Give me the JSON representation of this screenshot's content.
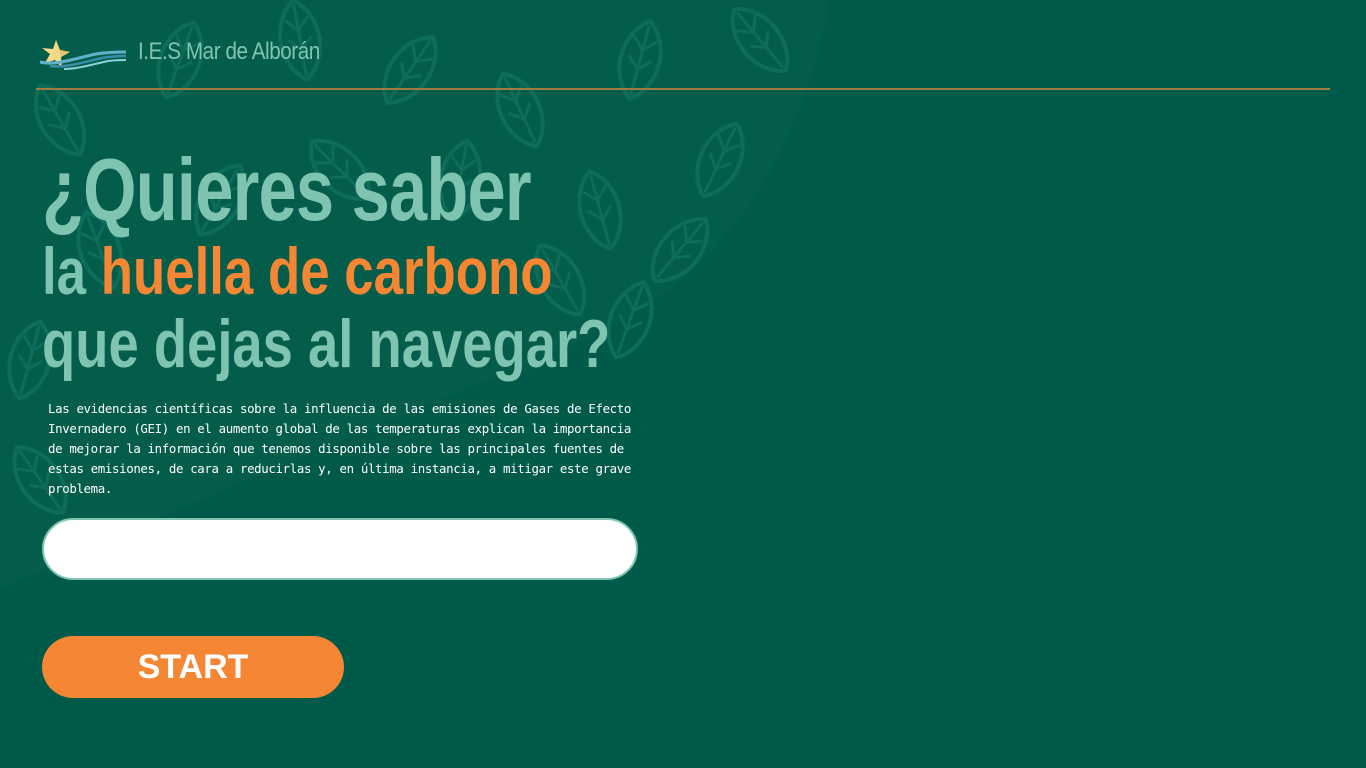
{
  "header": {
    "school_name": "I.E.S Mar de Alborán",
    "logo_icon": "star-wave-logo-icon"
  },
  "hero": {
    "line1": "¿Quieres saber",
    "line2_prefix": "la ",
    "line2_accent": "huella de carbono",
    "line3": "que dejas al navegar?"
  },
  "description": "Las evidencias científicas sobre la influencia de las emisiones de Gases de Efecto Invernadero (GEI) en el aumento global de las temperaturas explican la importancia de mejorar la información que tenemos disponible sobre las principales fuentes de estas emisiones, de cara a reducirlas y, en última instancia, a mitigar este grave problema.",
  "url_input": {
    "value": "",
    "placeholder": ""
  },
  "start_button": {
    "label": "START"
  },
  "colors": {
    "background": "#005a49",
    "accent": "#f58634",
    "mint_text": "#7ec4b0",
    "divider": "#a07a40"
  },
  "background_decoration": "leaf-pattern"
}
